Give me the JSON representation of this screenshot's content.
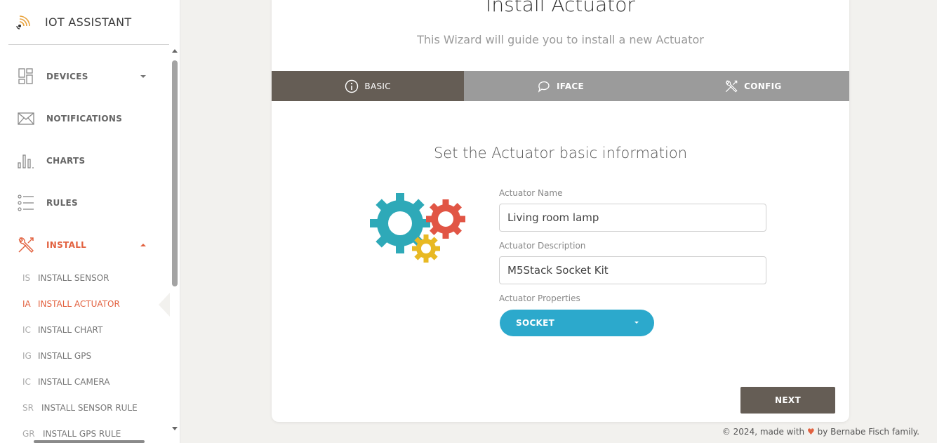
{
  "app": {
    "title": "IOT ASSISTANT"
  },
  "sidebar": {
    "items": [
      {
        "label": "DEVICES",
        "icon": "devices-icon",
        "expanded": false
      },
      {
        "label": "NOTIFICATIONS",
        "icon": "envelope-icon"
      },
      {
        "label": "CHARTS",
        "icon": "bar-chart-icon"
      },
      {
        "label": "RULES",
        "icon": "list-icon"
      },
      {
        "label": "INSTALL",
        "icon": "tools-icon",
        "expanded": true,
        "active": true
      }
    ],
    "subitems": [
      {
        "abbr": "IS",
        "label": "INSTALL SENSOR"
      },
      {
        "abbr": "IA",
        "label": "INSTALL ACTUATOR",
        "active": true
      },
      {
        "abbr": "IC",
        "label": "INSTALL CHART"
      },
      {
        "abbr": "IG",
        "label": "INSTALL GPS"
      },
      {
        "abbr": "IC",
        "label": "INSTALL CAMERA"
      },
      {
        "abbr": "SR",
        "label": "INSTALL SENSOR RULE"
      },
      {
        "abbr": "GR",
        "label": "INSTALL GPS RULE"
      }
    ]
  },
  "wizard": {
    "title": "Install Actuator",
    "subtitle": "This Wizard will guide you to install a new Actuator",
    "tabs": [
      {
        "label": "BASIC",
        "icon": "info-icon",
        "active": true
      },
      {
        "label": "IFACE",
        "icon": "chat-icon"
      },
      {
        "label": "CONFIG",
        "icon": "tools-icon"
      }
    ],
    "section_title": "Set the Actuator basic information",
    "fields": {
      "name_label": "Actuator Name",
      "name_value": "Living room lamp",
      "description_label": "Actuator Description",
      "description_value": "M5Stack Socket Kit",
      "properties_label": "Actuator Properties",
      "properties_value": "SOCKET"
    },
    "next_label": "NEXT"
  },
  "footer": {
    "prefix": "© 2024, made with",
    "heart": "♥",
    "suffix": "by Bernabe Fisch family."
  },
  "colors": {
    "accent": "#e2613f",
    "tab_active": "#655d55",
    "tab_inactive": "#9b9b9b",
    "select": "#2ca9cc",
    "gear_teal": "#2ea9b8",
    "gear_red": "#e15545",
    "gear_yellow": "#e8b923"
  }
}
